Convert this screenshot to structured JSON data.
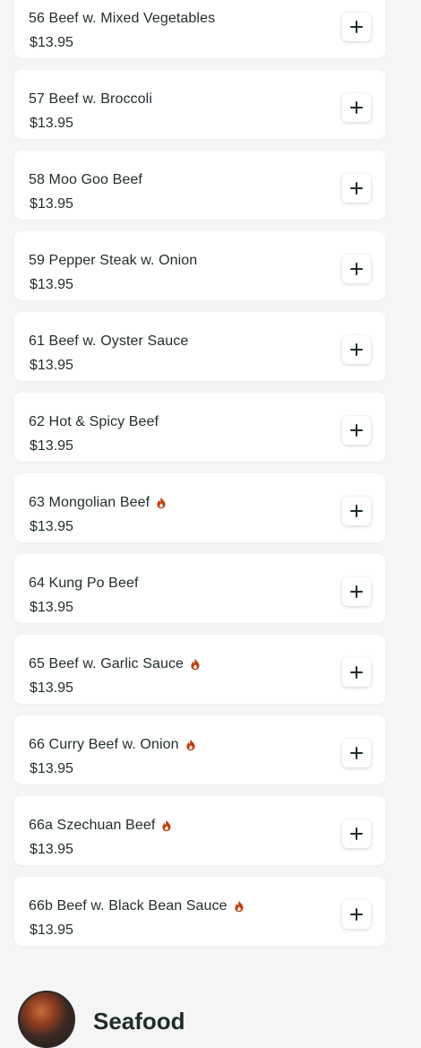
{
  "menu_items": [
    {
      "name": "56 Beef w. Mixed Vegetables",
      "price": "$13.95",
      "spicy": false
    },
    {
      "name": "57 Beef w. Broccoli",
      "price": "$13.95",
      "spicy": false
    },
    {
      "name": "58 Moo Goo Beef",
      "price": "$13.95",
      "spicy": false
    },
    {
      "name": "59 Pepper Steak w. Onion",
      "price": "$13.95",
      "spicy": false
    },
    {
      "name": "61 Beef w. Oyster Sauce",
      "price": "$13.95",
      "spicy": false
    },
    {
      "name": "62 Hot & Spicy Beef",
      "price": "$13.95",
      "spicy": false
    },
    {
      "name": "63 Mongolian Beef",
      "price": "$13.95",
      "spicy": true
    },
    {
      "name": "64 Kung Po Beef",
      "price": "$13.95",
      "spicy": false
    },
    {
      "name": "65 Beef w. Garlic Sauce",
      "price": "$13.95",
      "spicy": true
    },
    {
      "name": "66 Curry Beef w. Onion",
      "price": "$13.95",
      "spicy": true
    },
    {
      "name": "66a Szechuan Beef",
      "price": "$13.95",
      "spicy": true
    },
    {
      "name": "66b Beef w. Black Bean Sauce",
      "price": "$13.95",
      "spicy": true
    }
  ],
  "next_section": {
    "title": "Seafood"
  },
  "icons": {
    "add": "plus-icon",
    "spicy": "flame-icon"
  },
  "colors": {
    "spicy": "#c2410c",
    "text": "#1f2d2a",
    "background": "#f4f5f4"
  }
}
